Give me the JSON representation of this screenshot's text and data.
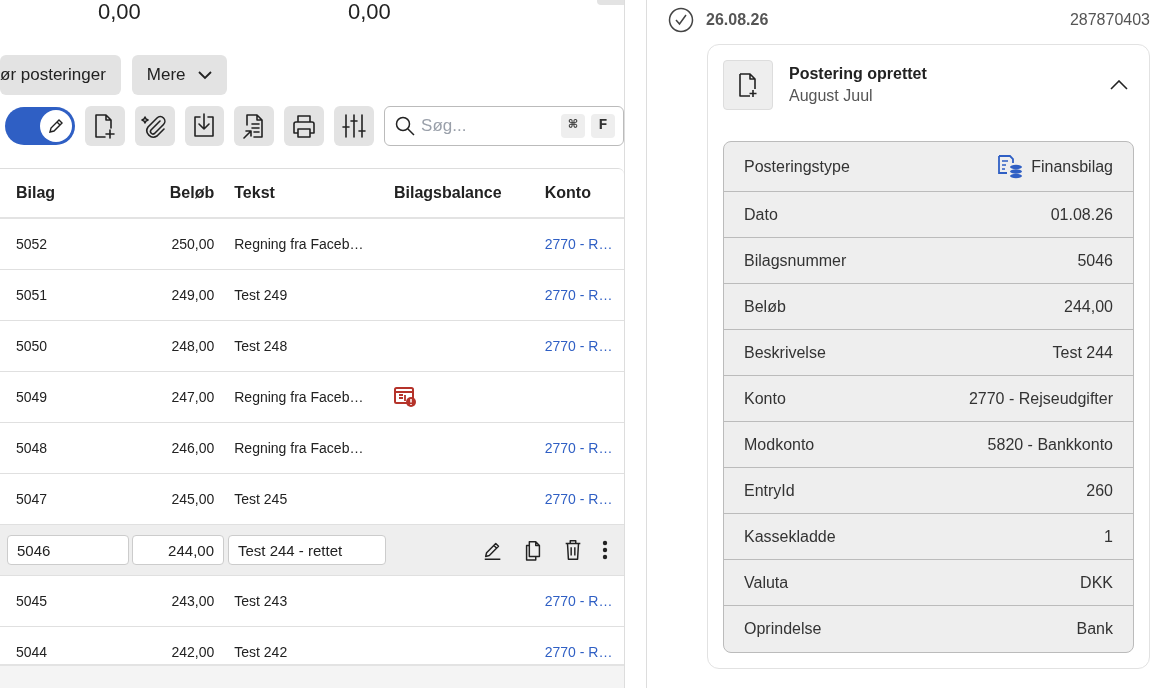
{
  "totals": [
    "0,00",
    "0,00"
  ],
  "actions": [
    {
      "label": "ør posteringer",
      "kind": "plain"
    },
    {
      "label": "Mere",
      "kind": "menu"
    }
  ],
  "toolbar": {
    "edit_mode": {
      "on": true
    },
    "tools": [
      {
        "kind": "new-doc"
      },
      {
        "kind": "attach"
      },
      {
        "kind": "download"
      },
      {
        "kind": "export"
      },
      {
        "kind": "print"
      },
      {
        "kind": "filter"
      }
    ],
    "search": {
      "placeholder": "Søg...",
      "keys": [
        "⌘",
        "F"
      ]
    }
  },
  "table": {
    "columns": [
      "Bilag",
      "Beløb",
      "Tekst",
      "Bilagsbalance",
      "Konto"
    ],
    "rows": [
      {
        "kind": "normal",
        "bilag": "5052",
        "belob": "250,00",
        "tekst": "Regning fra Faceb…",
        "balance_warning": false,
        "konto": "2770 - R…"
      },
      {
        "kind": "normal",
        "bilag": "5051",
        "belob": "249,00",
        "tekst": "Test 249",
        "balance_warning": false,
        "konto": "2770 - R…"
      },
      {
        "kind": "normal",
        "bilag": "5050",
        "belob": "248,00",
        "tekst": "Test 248",
        "balance_warning": false,
        "konto": "2770 - R…"
      },
      {
        "kind": "normal",
        "bilag": "5049",
        "belob": "247,00",
        "tekst": "Regning fra Faceb…",
        "balance_warning": true
      },
      {
        "kind": "normal",
        "bilag": "5048",
        "belob": "246,00",
        "tekst": "Regning fra Faceb…",
        "balance_warning": false,
        "konto": "2770 - R…"
      },
      {
        "kind": "normal",
        "bilag": "5047",
        "belob": "245,00",
        "tekst": "Test 245",
        "balance_warning": false,
        "konto": "2770 - R…"
      },
      {
        "kind": "edit",
        "bilag": "5046",
        "belob": "244,00",
        "tekst": "Test 244 - rettet"
      },
      {
        "kind": "normal",
        "bilag": "5045",
        "belob": "243,00",
        "tekst": "Test 243",
        "balance_warning": false,
        "konto": "2770 - R…"
      },
      {
        "kind": "normal",
        "bilag": "5044",
        "belob": "242,00",
        "tekst": "Test 242",
        "balance_warning": false,
        "konto": "2770 - R…"
      }
    ]
  },
  "history": {
    "date": "26.08.26",
    "id": "287870403",
    "event": {
      "title": "Postering oprettet",
      "user": "August Juul",
      "expanded": true,
      "details": [
        {
          "label": "Posteringstype",
          "value": "Finansbilag",
          "kind": "type"
        },
        {
          "label": "Dato",
          "value": "01.08.26"
        },
        {
          "label": "Bilagsnummer",
          "value": "5046"
        },
        {
          "label": "Beløb",
          "value": "244,00"
        },
        {
          "label": "Beskrivelse",
          "value": "Test 244"
        },
        {
          "label": "Konto",
          "value": "2770 - Rejseudgifter"
        },
        {
          "label": "Modkonto",
          "value": "5820 - Bankkonto"
        },
        {
          "label": "EntryId",
          "value": "260"
        },
        {
          "label": "Kassekladde",
          "value": "1"
        },
        {
          "label": "Valuta",
          "value": "DKK"
        },
        {
          "label": "Oprindelse",
          "value": "Bank"
        }
      ]
    }
  }
}
